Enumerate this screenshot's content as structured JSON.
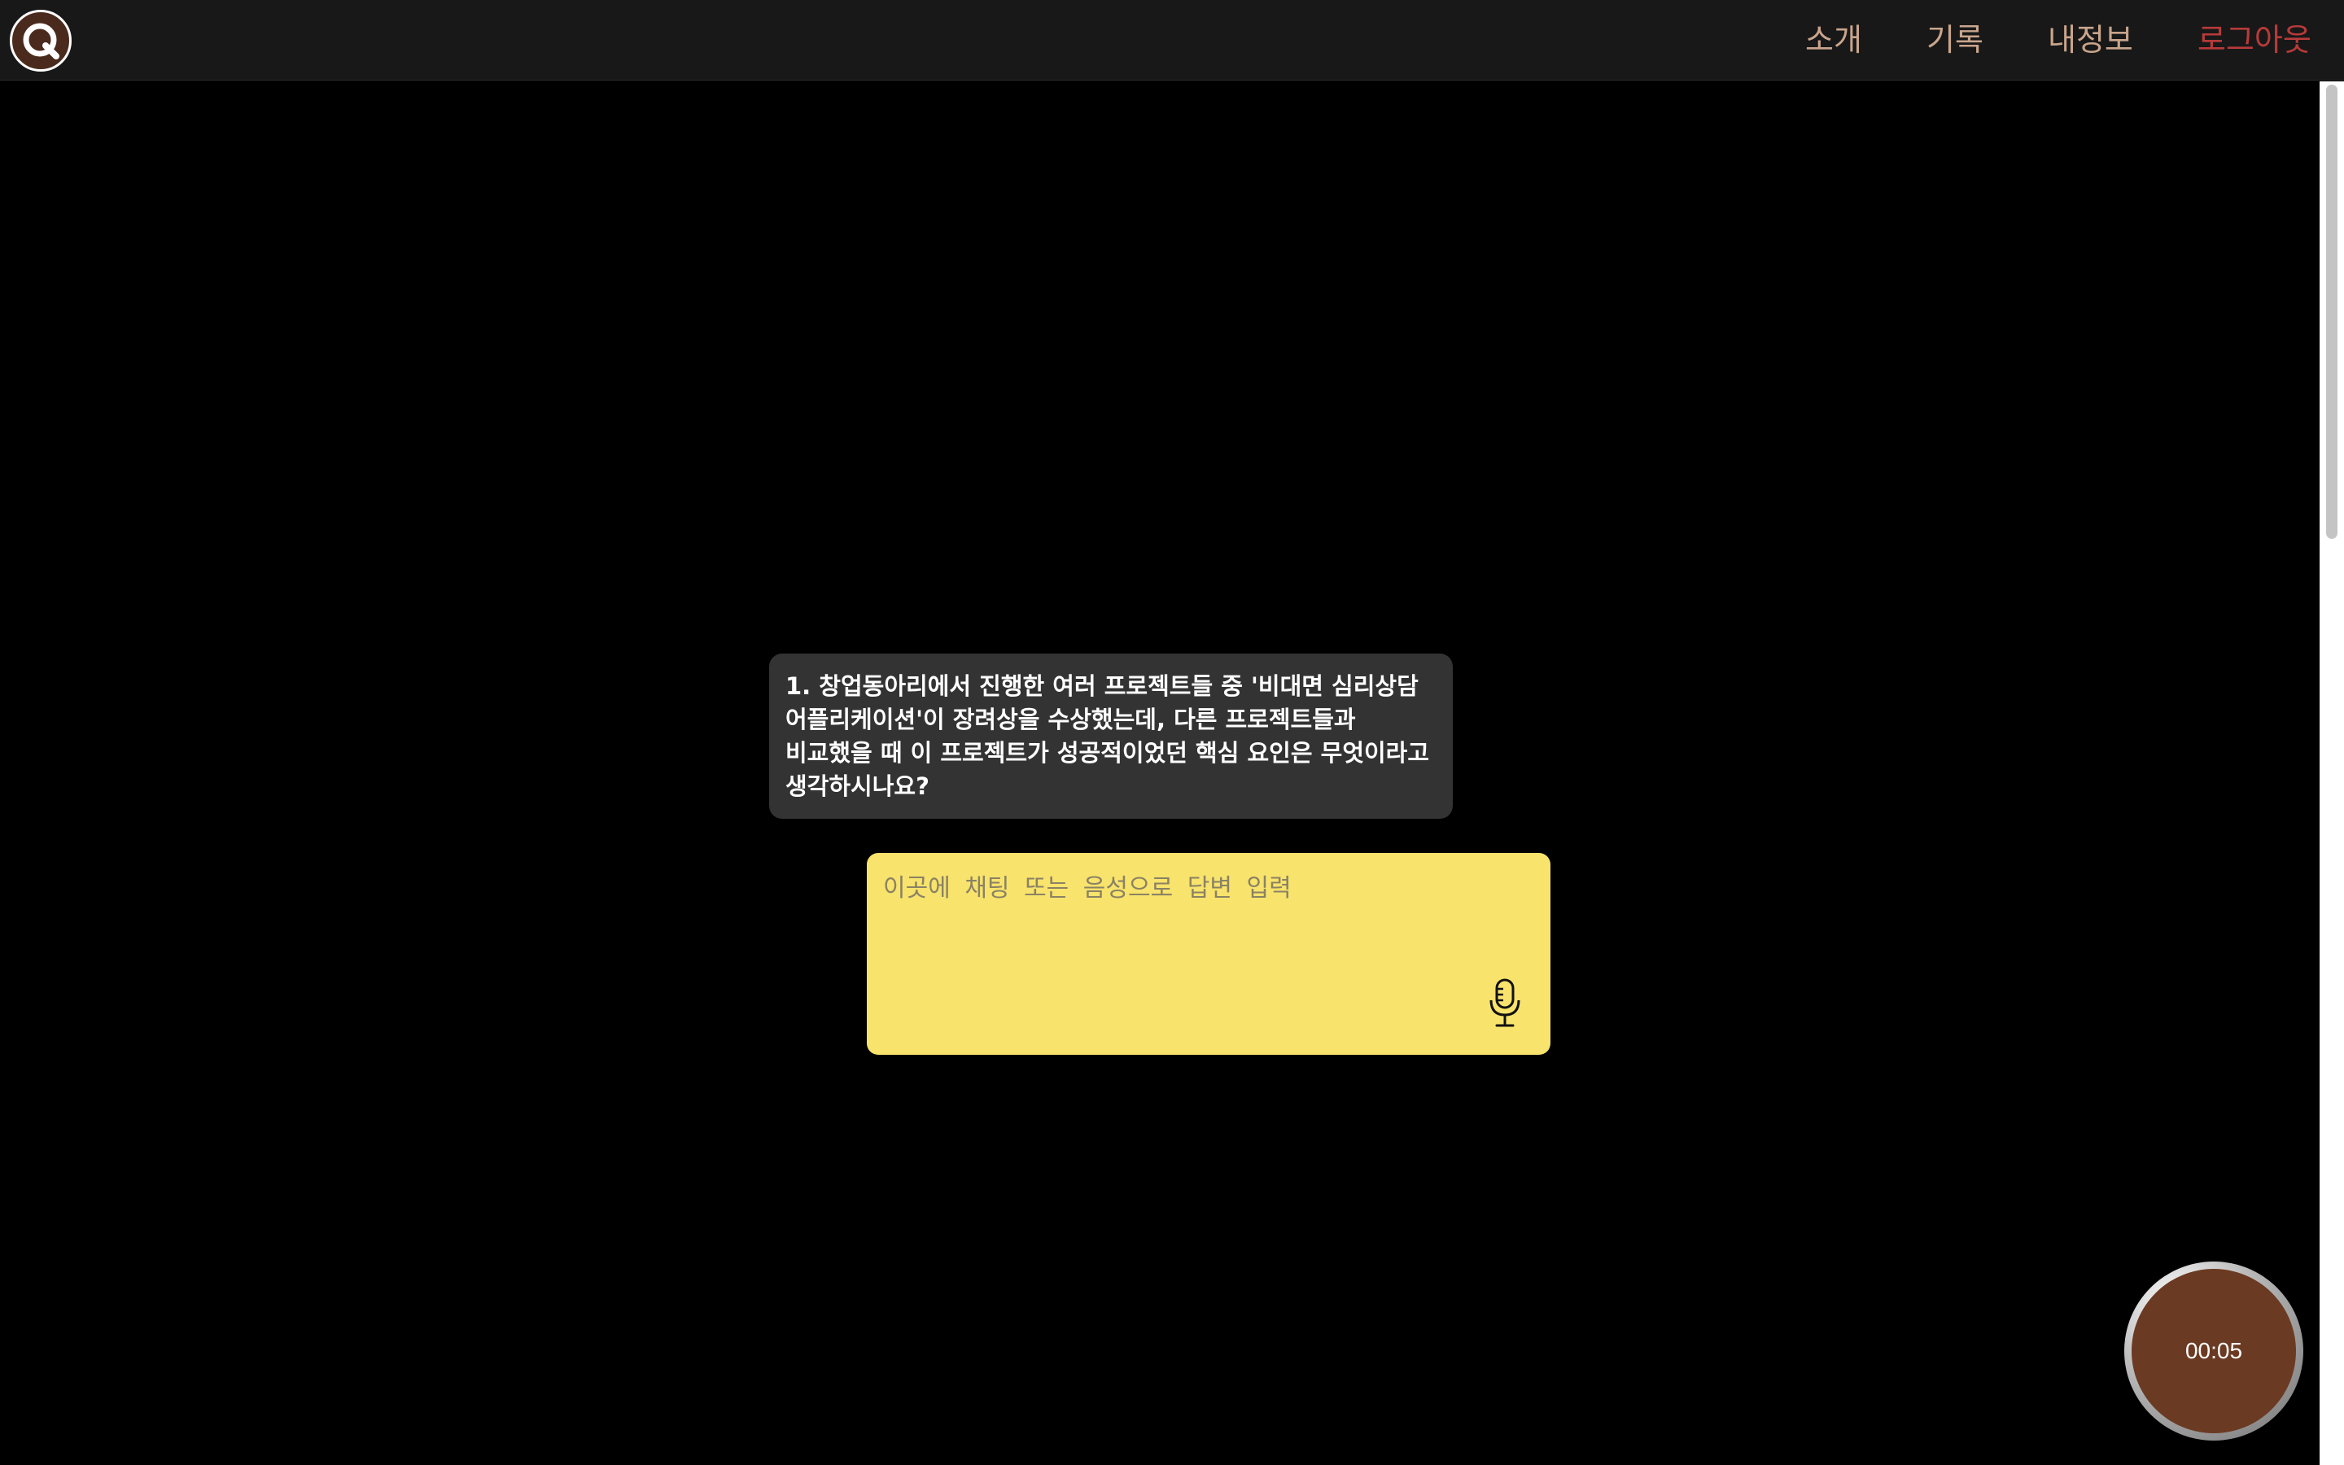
{
  "header": {
    "logo_icon": "q-logo-icon",
    "nav": {
      "intro": "소개",
      "history": "기록",
      "my_info": "내정보",
      "logout": "로그아웃"
    }
  },
  "question": {
    "text": "1. 창업동아리에서 진행한 여러 프로젝트들 중 '비대면 심리상담 어플리케이션'이 장려상을 수상했는데, 다른 프로젝트들과 비교했을 때 이 프로젝트가 성공적이었던 핵심 요인은 무엇이라고 생각하시나요?"
  },
  "answer": {
    "value": "",
    "placeholder": "이곳에 채팅 또는 음성으로 답변 입력",
    "mic_icon": "microphone-icon"
  },
  "timer": {
    "value": "00:05"
  },
  "colors": {
    "nav_text": "#c9a58c",
    "logout_text": "#b83a3a",
    "answer_bg": "#f8e36c",
    "bubble_bg": "#333333",
    "timer_fill": "#6b3a22"
  }
}
